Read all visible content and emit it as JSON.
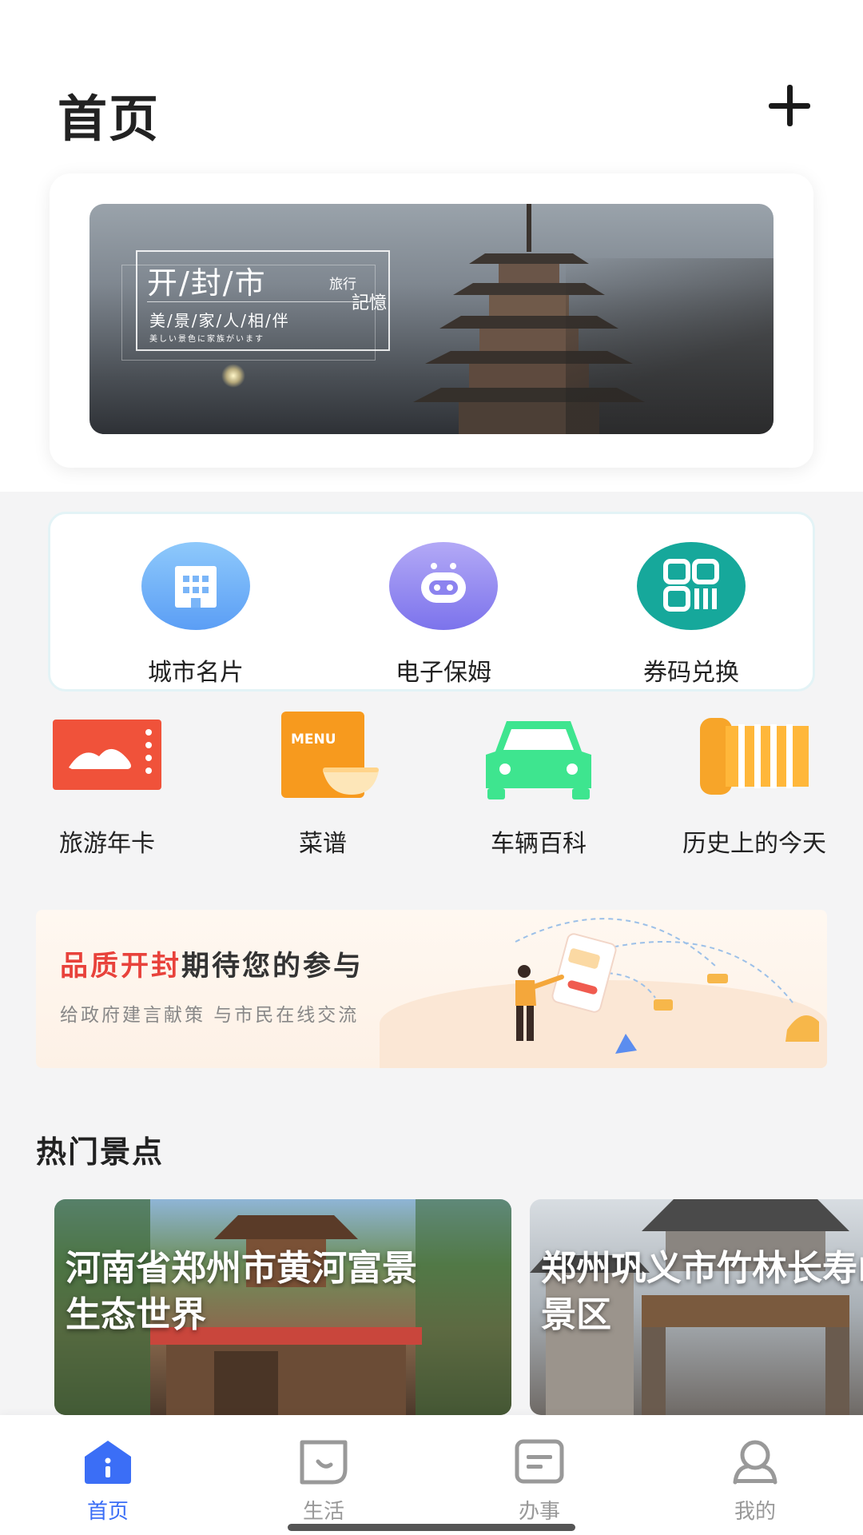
{
  "header": {
    "title": "首页"
  },
  "banner": {
    "title": "开/封/市",
    "travel": "旅行",
    "memory": "記憶",
    "subtitle": "美/景/家/人/相/伴",
    "jp_line": "美しい景色に家族がいます"
  },
  "services": [
    {
      "label": "城市名片",
      "icon": "building-icon",
      "color": "#6aaef8"
    },
    {
      "label": "电子保姆",
      "icon": "robot-icon",
      "color": "#8e86ef"
    },
    {
      "label": "券码兑换",
      "icon": "qrcode-icon",
      "color": "#16a89b"
    }
  ],
  "quick_links": [
    {
      "label": "旅游年卡",
      "icon": "ticket-icon",
      "color": "#f0523a"
    },
    {
      "label": "菜谱",
      "icon": "menu-book-icon",
      "color": "#f79a1e",
      "badge": "MENU"
    },
    {
      "label": "车辆百科",
      "icon": "car-icon",
      "color": "#3ee58f"
    },
    {
      "label": "历史上的今天",
      "icon": "scroll-icon",
      "color": "#f7a529"
    }
  ],
  "promo": {
    "title_highlight": "品质开封",
    "title_rest": "期待您的参与",
    "subtitle": "给政府建言献策 与市民在线交流"
  },
  "hot_spots": {
    "title": "热门景点",
    "items": [
      {
        "name": "河南省郑州市黄河富景生态世界",
        "line1": "河南省郑州市黄河富景",
        "line2": "生态世界"
      },
      {
        "name": "郑州巩义市竹林长寿山景区",
        "line1": "郑州巩义市竹林长寿山",
        "line2": "景区"
      }
    ]
  },
  "tabbar": {
    "items": [
      {
        "label": "首页",
        "icon": "home-icon",
        "active": true
      },
      {
        "label": "生活",
        "icon": "life-icon",
        "active": false
      },
      {
        "label": "办事",
        "icon": "tasks-icon",
        "active": false
      },
      {
        "label": "我的",
        "icon": "profile-icon",
        "active": false
      }
    ]
  },
  "colors": {
    "accent": "#3b6ef6",
    "promo_red": "#e8423b"
  }
}
